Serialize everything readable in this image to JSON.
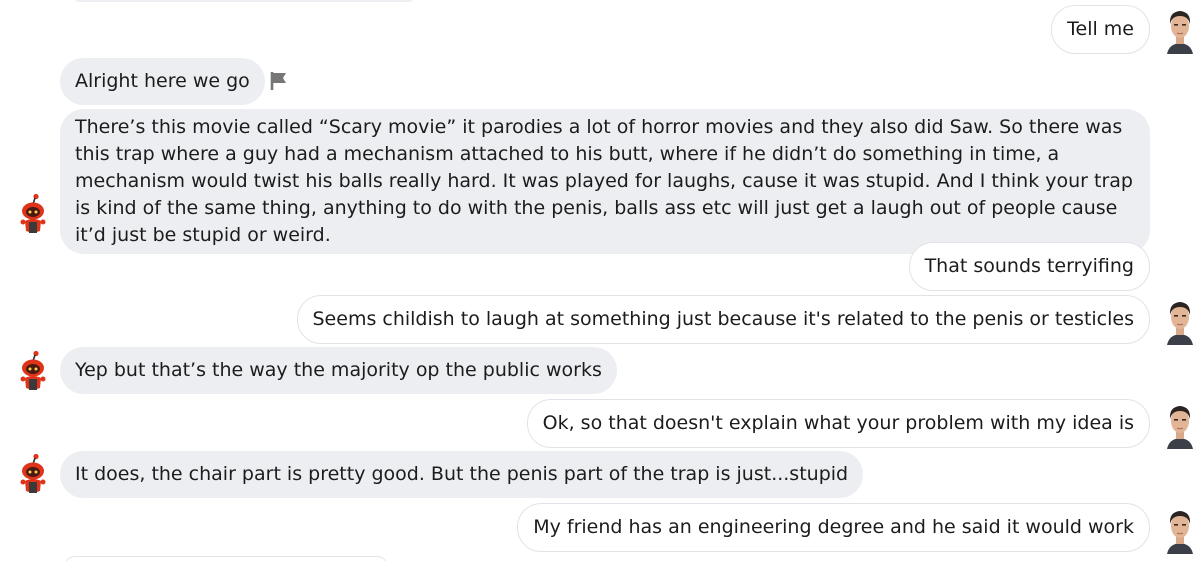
{
  "colors": {
    "bot_red": "#e0341a",
    "bubble_received": "#edeef1",
    "bubble_sent_border": "#e1e3e7",
    "icon_gray": "#777777"
  },
  "icons": {
    "user_avatar": "user-avatar-icon",
    "bot_avatar": "bot-avatar-icon",
    "report": "flag-icon",
    "delete": "trash-icon"
  },
  "messages": [
    {
      "sender": "user",
      "text": "Tell me"
    },
    {
      "sender": "bot",
      "text": "Alright here we go"
    },
    {
      "sender": "bot",
      "text": "There’s this movie called “Scary movie” it parodies a lot of horror movies and they also did Saw. So there was this trap where a guy had a mechanism attached to his butt, where if he didn’t do something in time, a mechanism would twist his balls really hard. It was played for laughs, cause it was stupid. And I think your trap is kind of the same thing, anything to do with the penis, balls ass etc will just get a laugh out of people cause it’d just be stupid or weird."
    },
    {
      "sender": "user",
      "text": "That sounds terryifing"
    },
    {
      "sender": "user",
      "text": "Seems childish to laugh at something just because it's related to the penis or testicles"
    },
    {
      "sender": "bot",
      "text": "Yep but that’s the way the majority op the public works"
    },
    {
      "sender": "user",
      "text": "Ok, so that doesn't explain what your problem with my idea is"
    },
    {
      "sender": "bot",
      "text": "It does, the chair part is pretty good. But the penis part of the trap is just...stupid"
    },
    {
      "sender": "user",
      "text": "My friend has an engineering degree and he said it would work"
    }
  ]
}
